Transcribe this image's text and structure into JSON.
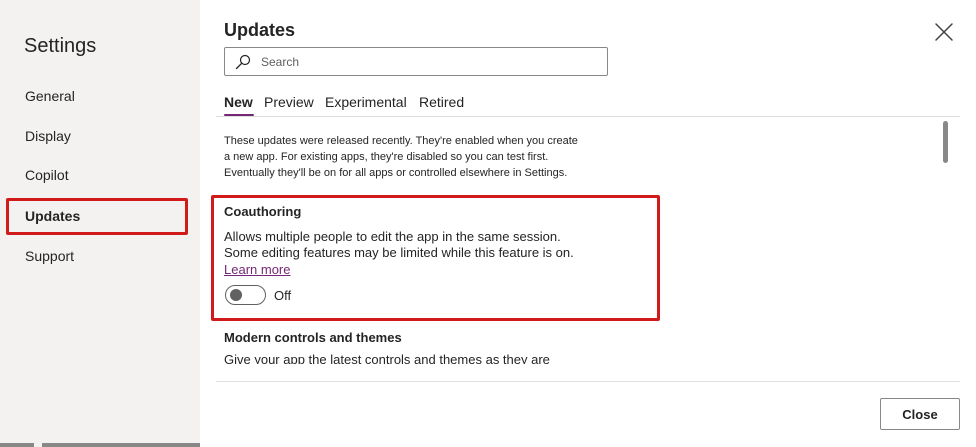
{
  "sidebar": {
    "title": "Settings",
    "items": [
      {
        "label": "General"
      },
      {
        "label": "Display"
      },
      {
        "label": "Copilot"
      },
      {
        "label": "Updates"
      },
      {
        "label": "Support"
      }
    ]
  },
  "main": {
    "title": "Updates",
    "search": {
      "placeholder": "Search",
      "value": ""
    },
    "tabs": [
      {
        "label": "New"
      },
      {
        "label": "Preview"
      },
      {
        "label": "Experimental"
      },
      {
        "label": "Retired"
      }
    ],
    "intro": {
      "line1": "These updates were released recently. They're enabled when you create",
      "line2": "a new app. For existing apps, they're disabled so you can test first.",
      "line3": "Eventually they'll be on for all apps or controlled elsewhere in Settings."
    },
    "features": [
      {
        "title": "Coauthoring",
        "desc_line1": "Allows multiple people to edit the app in the same session.",
        "desc_line2": "Some editing features may be limited while this feature is on.",
        "link": "Learn more",
        "toggle_state": "Off"
      },
      {
        "title": "Modern controls and themes",
        "desc_line1": "Give your app the latest controls and themes as they are"
      }
    ]
  },
  "footer": {
    "close_label": "Close"
  },
  "colors": {
    "accent": "#742774",
    "highlight": "#d11b1b",
    "sidebar_bg": "#f3f2f1"
  }
}
